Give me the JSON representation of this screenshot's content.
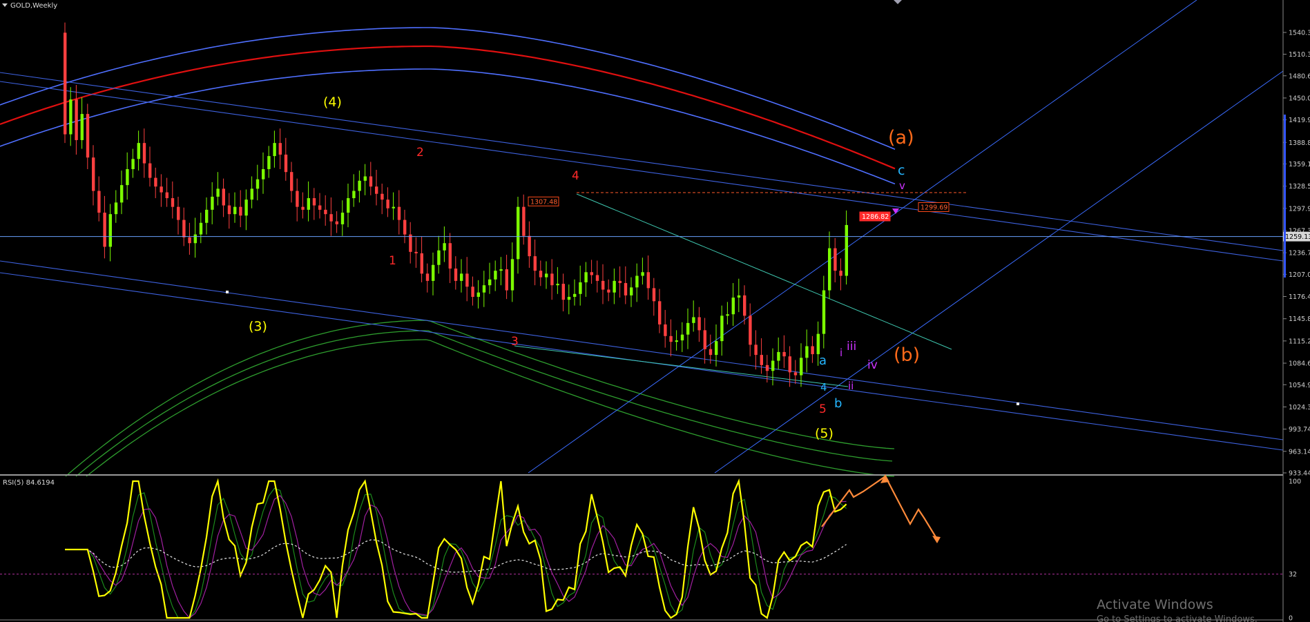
{
  "window": {
    "symbol_title": "GOLD,Weekly"
  },
  "indicator": {
    "label": "RSI(5) 84.6194"
  },
  "watermark": {
    "title": "Activate Windows",
    "subtitle": "Go to Settings to activate Windows."
  },
  "colors": {
    "background": "#000000",
    "bull": "#7cfc00",
    "bear": "#ff4040",
    "ma_red": "#e01010",
    "ma_blue": "#4f6fff",
    "ma_green": "#2e9e2e",
    "trend_line": "#3e62e0",
    "trend_thin": "#3b6cff",
    "rsi": "#ffff00",
    "rsi_sig_green": "#1b8a1b",
    "rsi_sig_magenta": "#a020a0",
    "label_yellow": "#ffff00",
    "label_red": "#ff2a2a",
    "label_orange": "#ff6a1a",
    "label_cyan": "#25b6ff",
    "label_purple": "#cc33ff"
  },
  "chart_data": [
    {
      "type": "candlestick",
      "title": "GOLD,Weekly",
      "y_ticks": [
        "1540.34",
        "1510.34",
        "1480.64",
        "1450.04",
        "1419.94",
        "1388.84",
        "1359.14",
        "1328.54",
        "1297.94",
        "1267.34",
        "1236.74",
        "1207.04",
        "1176.44",
        "1145.84",
        "1115.24",
        "1084.64",
        "1054.94",
        "1024.34",
        "993.74",
        "963.14",
        "933.44"
      ],
      "ylim": [
        933.44,
        1540.34
      ],
      "current_price_label": "1259.13",
      "current_price": 1259.13,
      "price_tags": [
        {
          "text": "1307.48",
          "value": 1307.48
        },
        {
          "text": "1286.82",
          "value": 1286.82
        },
        {
          "text": "1299.69",
          "value": 1299.69
        }
      ],
      "closes": [
        1400,
        1448,
        1392,
        1428,
        1368,
        1322,
        1292,
        1245,
        1290,
        1306,
        1330,
        1352,
        1366,
        1388,
        1360,
        1340,
        1328,
        1320,
        1312,
        1300,
        1282,
        1258,
        1250,
        1262,
        1278,
        1296,
        1314,
        1325,
        1302,
        1290,
        1300,
        1288,
        1310,
        1325,
        1338,
        1352,
        1370,
        1388,
        1372,
        1348,
        1322,
        1300,
        1296,
        1312,
        1302,
        1296,
        1290,
        1280,
        1276,
        1292,
        1312,
        1322,
        1336,
        1342,
        1328,
        1318,
        1310,
        1298,
        1300,
        1282,
        1262,
        1238,
        1236,
        1208,
        1198,
        1220,
        1240,
        1250,
        1215,
        1198,
        1208,
        1190,
        1176,
        1182,
        1192,
        1200,
        1212,
        1214,
        1185,
        1228,
        1300,
        1260,
        1232,
        1212,
        1203,
        1208,
        1192,
        1194,
        1172,
        1176,
        1180,
        1196,
        1210,
        1206,
        1198,
        1186,
        1182,
        1198,
        1195,
        1178,
        1189,
        1205,
        1210,
        1188,
        1170,
        1138,
        1122,
        1114,
        1116,
        1124,
        1140,
        1148,
        1130,
        1104,
        1096,
        1115,
        1150,
        1152,
        1175,
        1178,
        1150,
        1110,
        1096,
        1082,
        1074,
        1088,
        1100,
        1094,
        1072,
        1068,
        1092,
        1108,
        1097,
        1125,
        1185,
        1243,
        1212,
        1205,
        1275
      ],
      "wave_labels": [
        "(4)",
        "(3)",
        "(5)",
        "(a)",
        "(b)",
        "1",
        "2",
        "3",
        "4",
        "5",
        "a",
        "b",
        "c",
        "i",
        "ii",
        "iii",
        "iv",
        "v",
        "4"
      ]
    },
    {
      "type": "line",
      "title": "RSI(5) 84.6194",
      "y_ticks": [
        "100",
        "32",
        "0"
      ],
      "ylim": [
        0,
        100
      ],
      "level": 32,
      "series": []
    }
  ]
}
